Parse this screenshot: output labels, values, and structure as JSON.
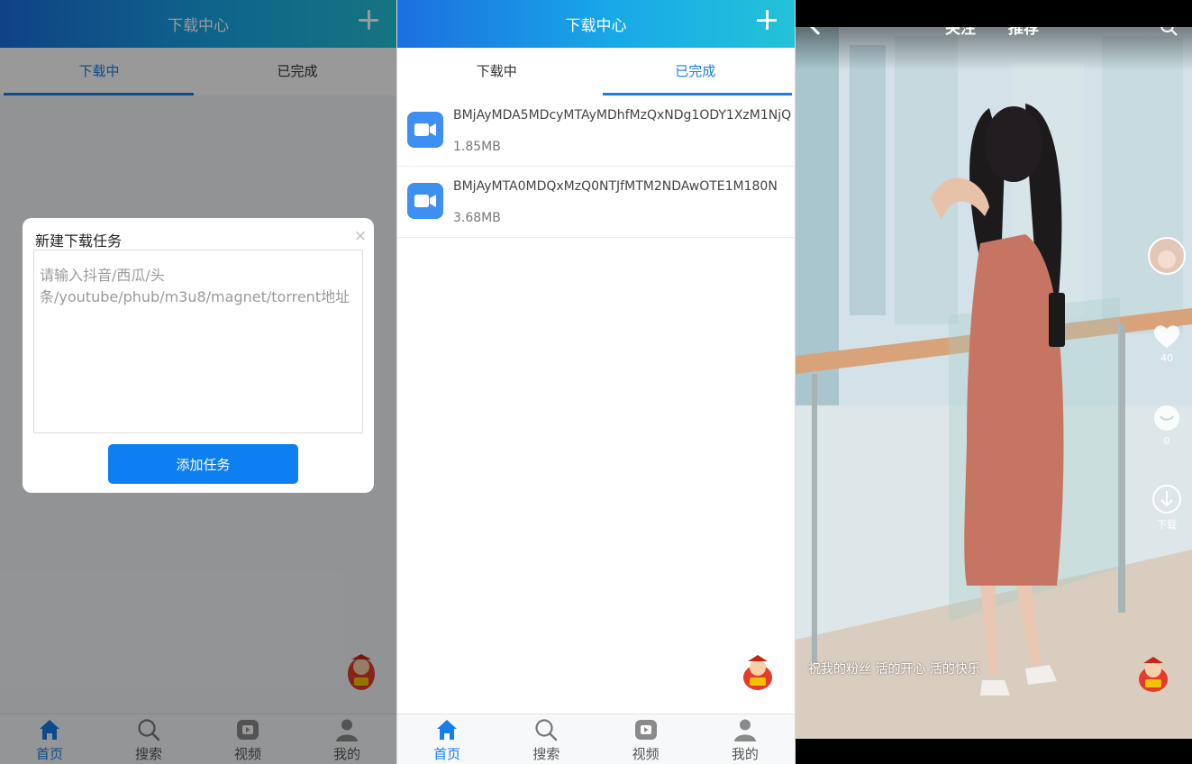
{
  "header": {
    "title": "下载中心"
  },
  "tabs": {
    "downloading": "下载中",
    "completed": "已完成"
  },
  "dialog": {
    "title": "新建下载任务",
    "close": "×",
    "placeholder": "请输入抖音/西瓜/头条/youtube/phub/m3u8/magnet/torrent地址",
    "button": "添加任务"
  },
  "files": [
    {
      "name": "BMjAyMDA5MDcyMTAyMDhfMzQxNDg1ODY1XzM1NjQ",
      "size": "1.85MB"
    },
    {
      "name": "BMjAyMTA0MDQxMzQ0NTJfMTM2NDAwOTE1M180N",
      "size": "3.68MB"
    }
  ],
  "nav": [
    {
      "label": "首页",
      "icon": "home-icon"
    },
    {
      "label": "搜索",
      "icon": "search-icon"
    },
    {
      "label": "视频",
      "icon": "video-icon"
    },
    {
      "label": "我的",
      "icon": "profile-icon"
    }
  ],
  "video": {
    "tabs": [
      "关注",
      "推荐"
    ],
    "like_count": "40",
    "comment_count": "0",
    "download_label": "下载",
    "caption": "祝我的粉丝 活的开心 活的快乐"
  },
  "colors": {
    "accent": "#1a7ee8",
    "header_start": "#1c6fe0",
    "header_end": "#24c2d8",
    "button": "#0d7ff0",
    "file_icon": "#3e8ff2"
  }
}
